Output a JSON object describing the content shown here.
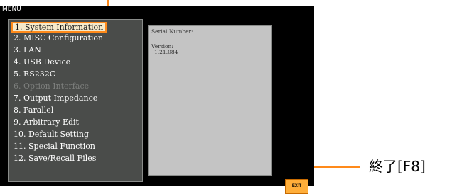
{
  "screen": {
    "title": "MENU",
    "menu_items": [
      {
        "label": "1. System Information",
        "selected": true
      },
      {
        "label": "2. MISC Configuration"
      },
      {
        "label": "3. LAN"
      },
      {
        "label": "4. USB Device"
      },
      {
        "label": "5. RS232C"
      },
      {
        "label": "6. Option Interface",
        "disabled": true
      },
      {
        "label": "7. Output Impedance"
      },
      {
        "label": "8. Parallel"
      },
      {
        "label": "9. Arbitrary Edit"
      },
      {
        "label": "10. Default Setting"
      },
      {
        "label": "11. Special Function"
      },
      {
        "label": "12. Save/Recall Files"
      }
    ],
    "info": {
      "serial_label": "Serial Number:",
      "version_label": "Version:",
      "version_value": "1.21.084"
    },
    "exit_label": "EXIT"
  },
  "callout": {
    "text": "終了[F8]"
  },
  "colors": {
    "highlight": "#ff8a1a",
    "exit_button": "#ffae3a"
  }
}
